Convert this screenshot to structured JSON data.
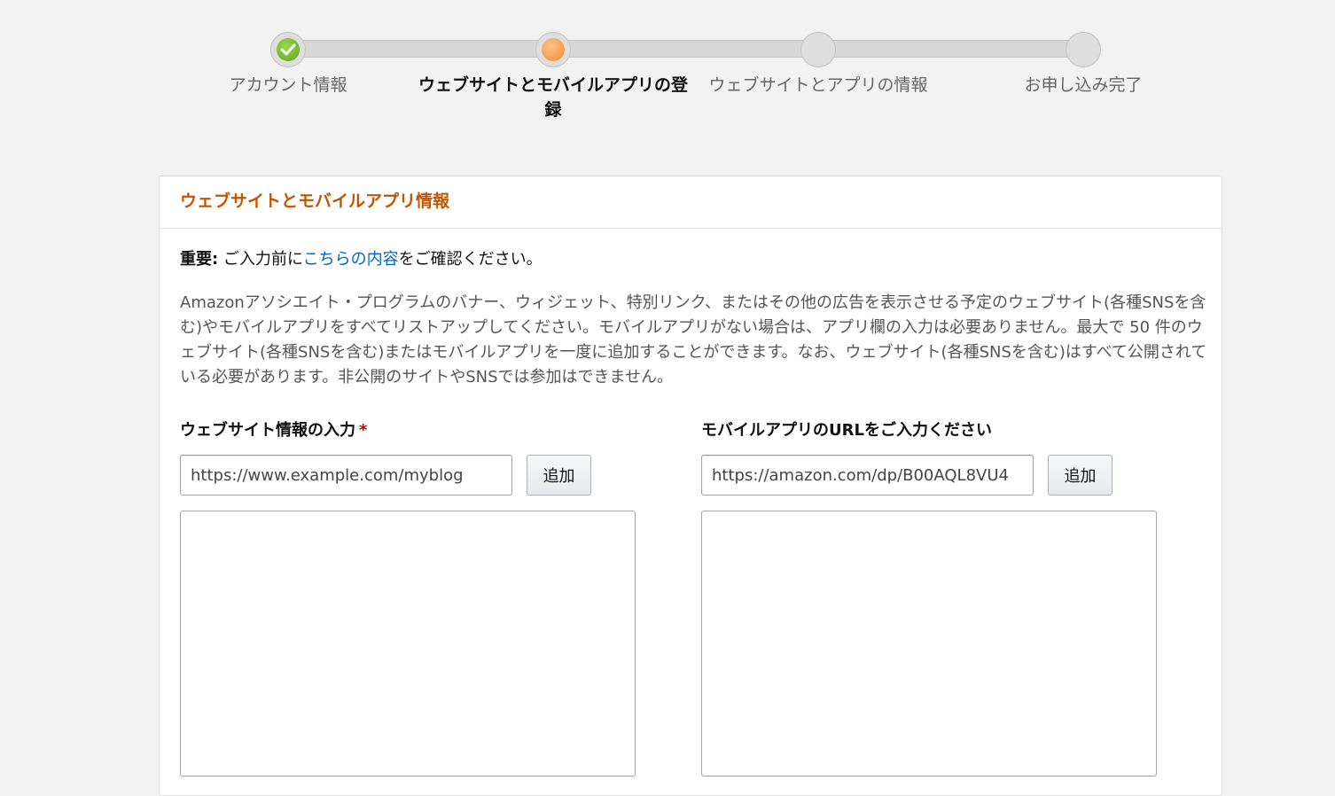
{
  "stepper": {
    "steps": [
      {
        "label": "アカウント情報",
        "state": "done"
      },
      {
        "label": "ウェブサイトとモバイルアプリの登録",
        "state": "current"
      },
      {
        "label": "ウェブサイトとアプリの情報",
        "state": "pending"
      },
      {
        "label": "お申し込み完了",
        "state": "pending"
      }
    ]
  },
  "panel": {
    "title": "ウェブサイトとモバイルアプリ情報",
    "important": {
      "prefix": "重要:",
      "before_link": " ご入力前に",
      "link": "こちらの内容",
      "after_link": "をご確認ください。"
    },
    "description": "Amazonアソシエイト・プログラムのバナー、ウィジェット、特別リンク、またはその他の広告を表示させる予定のウェブサイト(各種SNSを含む)やモバイルアプリをすべてリストアップしてください。モバイルアプリがない場合は、アプリ欄の入力は必要ありません。最大で 50 件のウェブサイト(各種SNSを含む)またはモバイルアプリを一度に追加することができます。なお、ウェブサイト(各種SNSを含む)はすべて公開されている必要があります。非公開のサイトやSNSでは参加はできません。",
    "website": {
      "label": "ウェブサイト情報の入力",
      "required_mark": "*",
      "placeholder": "https://www.example.com/myblog",
      "add_label": "追加"
    },
    "app": {
      "label": "モバイルアプリのURLをご入力ください",
      "placeholder": "https://amazon.com/dp/B00AQL8VU4",
      "add_label": "追加"
    }
  },
  "colors": {
    "background": "#f2f2f2",
    "title": "#c45500",
    "link": "#0066c0",
    "required": "#c40000",
    "done_step": "#6ab42a",
    "current_step": "#f28a28"
  }
}
